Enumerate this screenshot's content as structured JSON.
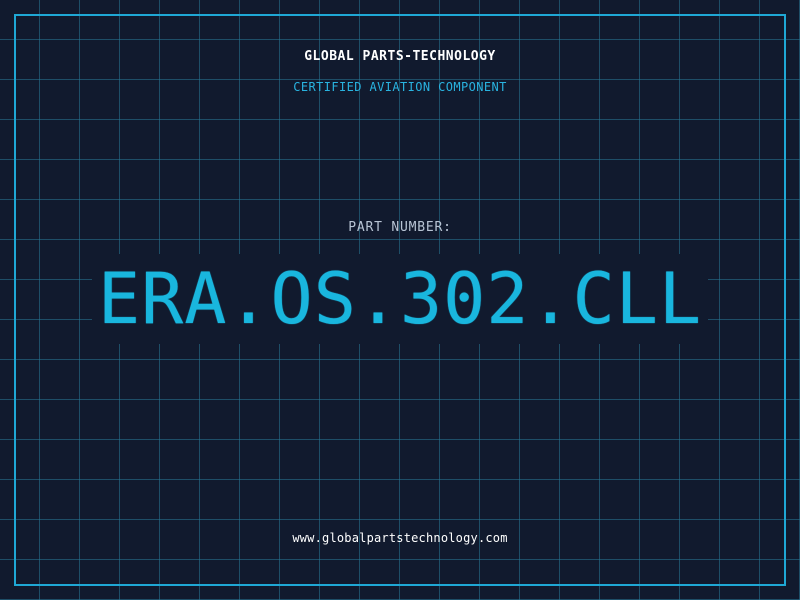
{
  "header": {
    "brand": "GLOBAL PARTS-TECHNOLOGY",
    "tagline": "CERTIFIED AVIATION COMPONENT"
  },
  "part": {
    "label": "PART NUMBER:",
    "number": "ERA.OS.302.CLL"
  },
  "footer": {
    "website": "www.globalpartstechnology.com"
  },
  "colors": {
    "background": "#111a2e",
    "grid": "#28789a",
    "accent": "#19b6de",
    "frame": "#1fa8d6",
    "text_primary": "#ffffff",
    "text_muted": "#b8c4d4"
  }
}
